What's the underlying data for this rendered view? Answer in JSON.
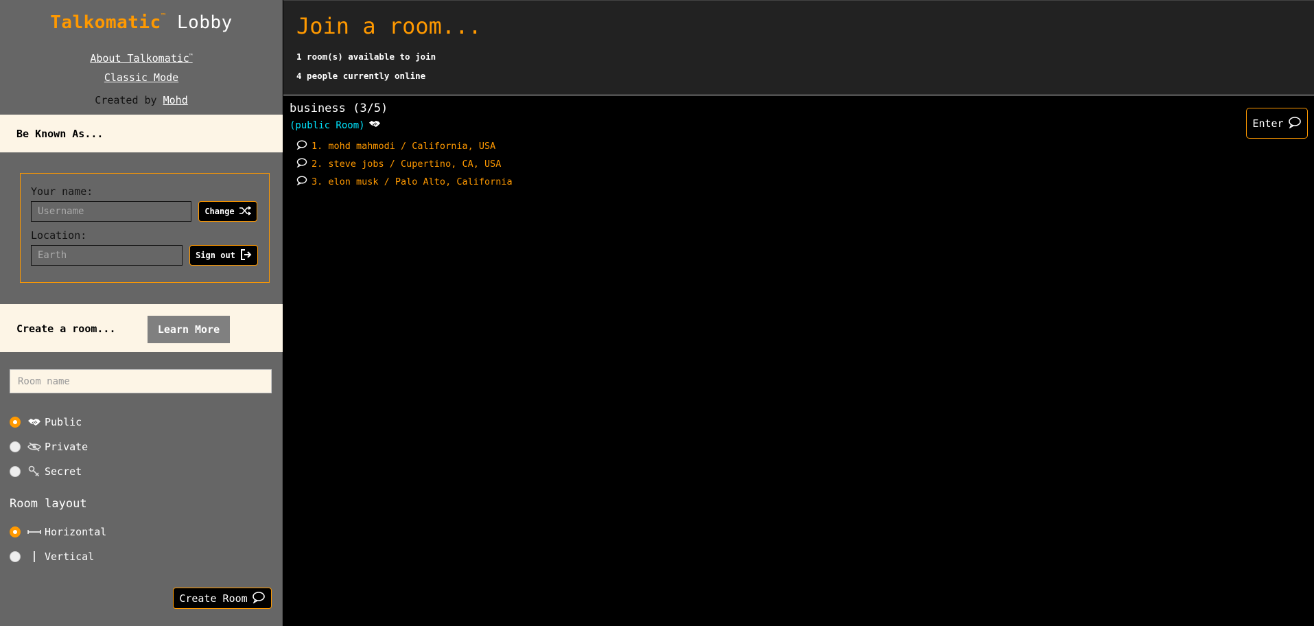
{
  "brand": {
    "name": "Talkomatic",
    "tm": "™",
    "lobby": "Lobby"
  },
  "sidebar": {
    "about_link": "About Talkomatic",
    "about_tm": "™",
    "classic_link": "Classic Mode",
    "created_by": "Created by",
    "author": "Mohd",
    "be_known_as": "Be Known As...",
    "name_label": "Your name:",
    "name_placeholder": "Username",
    "change_button": "Change",
    "location_label": "Location:",
    "location_placeholder": "Earth",
    "signout_button": "Sign out",
    "create_room_label": "Create a room...",
    "learn_more_button": "Learn More",
    "room_name_placeholder": "Room name",
    "room_types": [
      {
        "label": "Public",
        "checked": true,
        "icon": "handshake-icon"
      },
      {
        "label": "Private",
        "checked": false,
        "icon": "eye-slash-icon"
      },
      {
        "label": "Secret",
        "checked": false,
        "icon": "key-icon"
      }
    ],
    "room_layout_title": "Room layout",
    "layouts": [
      {
        "label": "Horizontal",
        "checked": true,
        "icon": "horizontal-line-icon"
      },
      {
        "label": "Vertical",
        "checked": false,
        "icon": "vertical-line-icon"
      }
    ],
    "create_room_button": "Create Room"
  },
  "main": {
    "title": "Join a room...",
    "rooms_available": "1 room(s) available to join",
    "people_online": "4 people currently online",
    "rooms": [
      {
        "name": "business (3/5)",
        "type": "(public Room)",
        "enter_button": "Enter",
        "users": [
          "1. mohd mahmodi / California, USA",
          "2. steve jobs / Cupertino, CA, USA",
          "3. elon musk / Palo Alto, California"
        ]
      }
    ]
  },
  "colors": {
    "accent": "#ff9900",
    "cream": "#fdf5e6",
    "cyan": "#00e5ff",
    "sidebar": "#666666"
  }
}
